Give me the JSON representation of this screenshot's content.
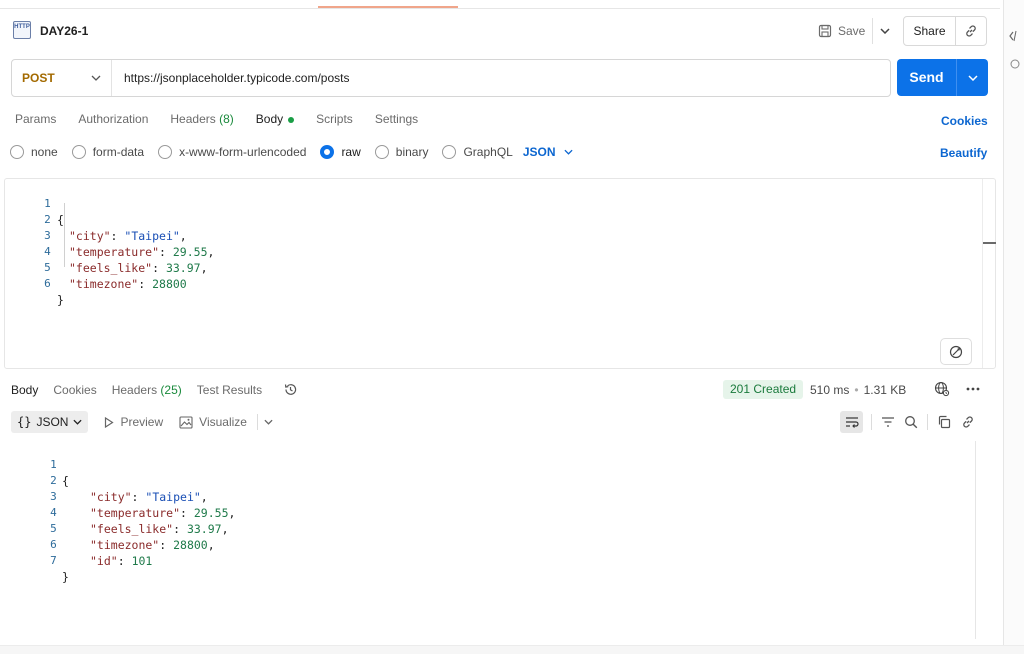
{
  "request": {
    "title": "DAY26-1",
    "http_icon_text": "HTTP",
    "save_label": "Save",
    "share_label": "Share",
    "method": "POST",
    "url": "https://jsonplaceholder.typicode.com/posts",
    "send_label": "Send"
  },
  "request_tabs": [
    {
      "label": "Params"
    },
    {
      "label": "Authorization"
    },
    {
      "label": "Headers",
      "count": "(8)"
    },
    {
      "label": "Body"
    },
    {
      "label": "Scripts"
    },
    {
      "label": "Settings"
    }
  ],
  "cookies_label": "Cookies",
  "body_types": {
    "none": "none",
    "form_data": "form-data",
    "urlencoded": "x-www-form-urlencoded",
    "raw": "raw",
    "binary": "binary",
    "graphql": "GraphQL",
    "selected_format": "JSON"
  },
  "beautify_label": "Beautify",
  "request_body": {
    "line_numbers": [
      "1",
      "2",
      "3",
      "4",
      "5",
      "6"
    ],
    "open": "{",
    "close": "}",
    "fields": [
      {
        "key": "\"city\"",
        "sep": ": ",
        "value": "\"Taipei\"",
        "type": "string",
        "tail": ","
      },
      {
        "key": "\"temperature\"",
        "sep": ": ",
        "value": "29.55",
        "type": "number",
        "tail": ","
      },
      {
        "key": "\"feels_like\"",
        "sep": ": ",
        "value": "33.97",
        "type": "number",
        "tail": ","
      },
      {
        "key": "\"timezone\"",
        "sep": ": ",
        "value": "28800",
        "type": "number",
        "tail": ""
      }
    ]
  },
  "response": {
    "tabs": [
      {
        "label": "Body"
      },
      {
        "label": "Cookies"
      },
      {
        "label": "Headers",
        "count": "(25)"
      },
      {
        "label": "Test Results"
      }
    ],
    "status": "201 Created",
    "time": "510 ms",
    "size": "1.31 KB",
    "format": "JSON",
    "preview_label": "Preview",
    "visualize_label": "Visualize",
    "line_numbers": [
      "1",
      "2",
      "3",
      "4",
      "5",
      "6",
      "7"
    ],
    "open": "{",
    "close": "}",
    "fields": [
      {
        "key": "\"city\"",
        "sep": ": ",
        "value": "\"Taipei\"",
        "type": "string",
        "tail": ","
      },
      {
        "key": "\"temperature\"",
        "sep": ": ",
        "value": "29.55",
        "type": "number",
        "tail": ","
      },
      {
        "key": "\"feels_like\"",
        "sep": ": ",
        "value": "33.97",
        "type": "number",
        "tail": ","
      },
      {
        "key": "\"timezone\"",
        "sep": ": ",
        "value": "28800",
        "type": "number",
        "tail": ","
      },
      {
        "key": "\"id\"",
        "sep": ": ",
        "value": "101",
        "type": "number",
        "tail": ""
      }
    ]
  },
  "colors": {
    "send_button": "#0c72e8",
    "method_post": "#a36a00",
    "link_blue": "#0c66d0",
    "status_green": "#1a7a3c",
    "json_key": "#8a2b2b",
    "json_string": "#1a4fb5",
    "json_number": "#1f7a4a"
  },
  "icons": {
    "save": "save-icon",
    "share_link": "link-icon",
    "history": "history-icon",
    "globe": "globe-icon",
    "more": "more-icon",
    "wrap": "wrap-lines-icon",
    "filter": "filter-icon",
    "search": "search-icon",
    "copy": "copy-icon",
    "link": "link-icon",
    "magic": "magic-icon"
  }
}
